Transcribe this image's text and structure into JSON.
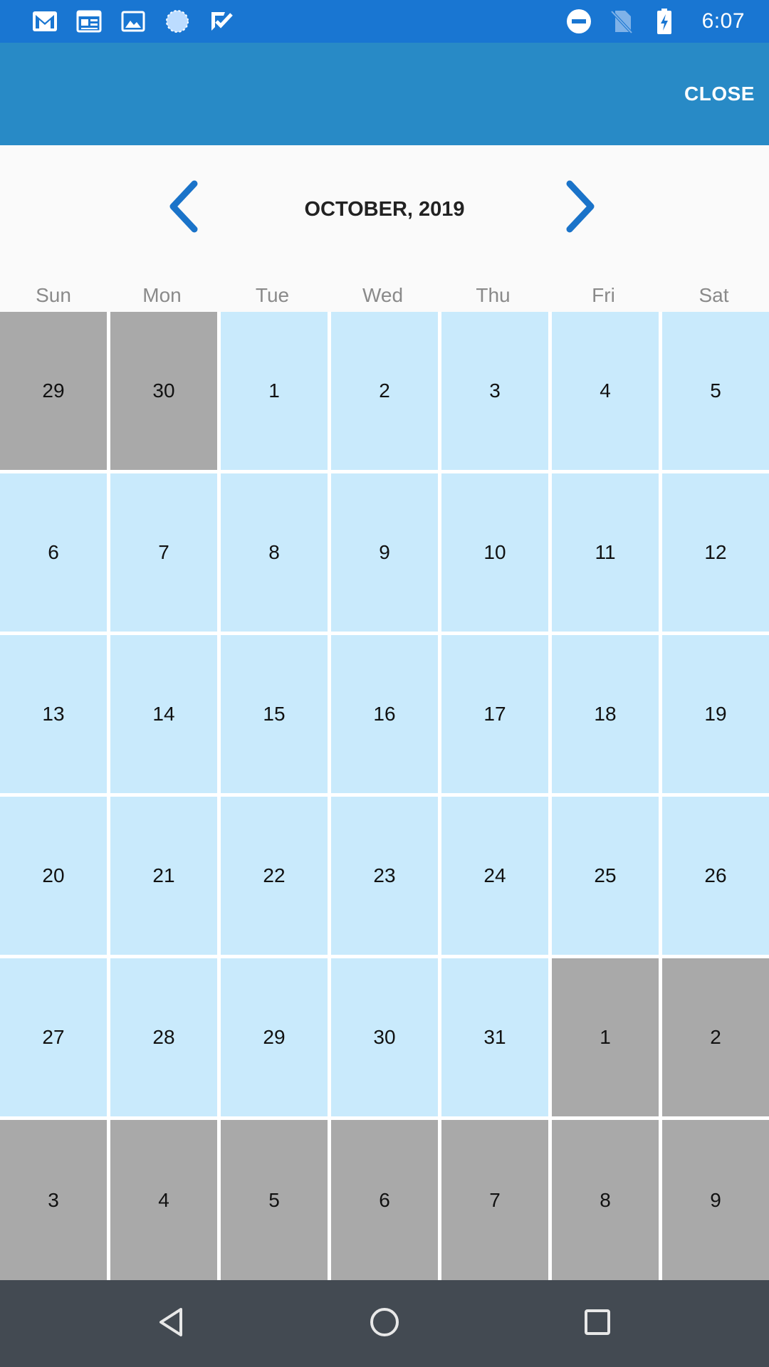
{
  "status_bar": {
    "time": "6:07",
    "left_icons": [
      "gmail-icon",
      "calendar-news-icon",
      "image-icon",
      "sync-icon",
      "tasks-check-icon"
    ],
    "right_icons": [
      "do-not-disturb-icon",
      "no-sim-icon",
      "battery-charging-icon"
    ]
  },
  "app_bar": {
    "close_label": "CLOSE",
    "background": "#288ac6"
  },
  "calendar": {
    "month_title": "OCTOBER, 2019",
    "weekdays": [
      "Sun",
      "Mon",
      "Tue",
      "Wed",
      "Thu",
      "Fri",
      "Sat"
    ],
    "in_month_color": "#c9eafc",
    "out_month_color": "#a9a9a9",
    "weeks": [
      [
        {
          "d": "29",
          "in": false
        },
        {
          "d": "30",
          "in": false
        },
        {
          "d": "1",
          "in": true
        },
        {
          "d": "2",
          "in": true
        },
        {
          "d": "3",
          "in": true
        },
        {
          "d": "4",
          "in": true
        },
        {
          "d": "5",
          "in": true
        }
      ],
      [
        {
          "d": "6",
          "in": true
        },
        {
          "d": "7",
          "in": true
        },
        {
          "d": "8",
          "in": true
        },
        {
          "d": "9",
          "in": true
        },
        {
          "d": "10",
          "in": true
        },
        {
          "d": "11",
          "in": true
        },
        {
          "d": "12",
          "in": true
        }
      ],
      [
        {
          "d": "13",
          "in": true
        },
        {
          "d": "14",
          "in": true
        },
        {
          "d": "15",
          "in": true
        },
        {
          "d": "16",
          "in": true
        },
        {
          "d": "17",
          "in": true
        },
        {
          "d": "18",
          "in": true
        },
        {
          "d": "19",
          "in": true
        }
      ],
      [
        {
          "d": "20",
          "in": true
        },
        {
          "d": "21",
          "in": true
        },
        {
          "d": "22",
          "in": true
        },
        {
          "d": "23",
          "in": true
        },
        {
          "d": "24",
          "in": true
        },
        {
          "d": "25",
          "in": true
        },
        {
          "d": "26",
          "in": true
        }
      ],
      [
        {
          "d": "27",
          "in": true
        },
        {
          "d": "28",
          "in": true
        },
        {
          "d": "29",
          "in": true
        },
        {
          "d": "30",
          "in": true
        },
        {
          "d": "31",
          "in": true
        },
        {
          "d": "1",
          "in": false
        },
        {
          "d": "2",
          "in": false
        }
      ],
      [
        {
          "d": "3",
          "in": false
        },
        {
          "d": "4",
          "in": false
        },
        {
          "d": "5",
          "in": false
        },
        {
          "d": "6",
          "in": false
        },
        {
          "d": "7",
          "in": false
        },
        {
          "d": "8",
          "in": false
        },
        {
          "d": "9",
          "in": false
        }
      ]
    ]
  },
  "system_nav": {
    "keys": [
      "back-icon",
      "home-icon",
      "recents-icon"
    ]
  }
}
